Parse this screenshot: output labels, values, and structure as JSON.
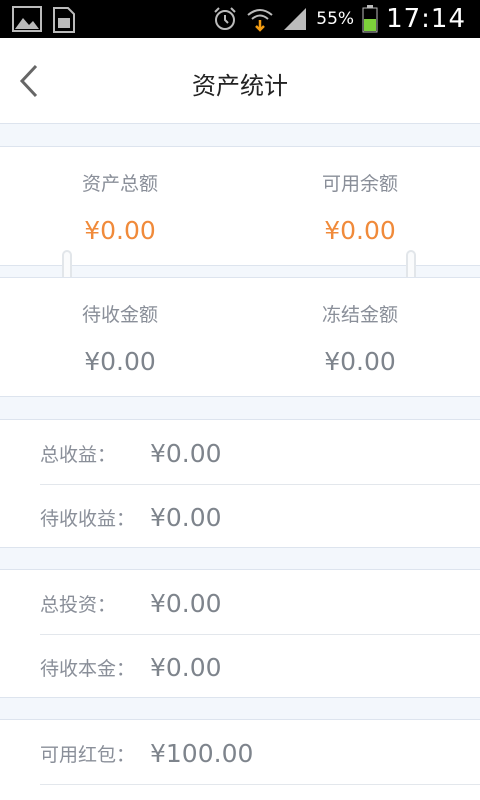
{
  "status_bar": {
    "battery_percent": "55%",
    "time": "17:14",
    "icons": [
      "image-icon",
      "sim-card-icon",
      "alarm-icon",
      "wifi-download-icon",
      "signal-icon",
      "battery-icon"
    ]
  },
  "header": {
    "title": "资产统计",
    "back_icon": "chevron-left-icon"
  },
  "summary": {
    "total_assets_label": "资产总额",
    "total_assets_value": "¥0.00",
    "available_balance_label": "可用余额",
    "available_balance_value": "¥0.00",
    "pending_amount_label": "待收金额",
    "pending_amount_value": "¥0.00",
    "frozen_amount_label": "冻结金额",
    "frozen_amount_value": "¥0.00"
  },
  "earnings": {
    "total_earnings_label": "总收益：",
    "total_earnings_value": "¥0.00",
    "pending_earnings_label": "待收收益：",
    "pending_earnings_value": "¥0.00"
  },
  "investment": {
    "total_investment_label": "总投资：",
    "total_investment_value": "¥0.00",
    "pending_principal_label": "待收本金：",
    "pending_principal_value": "¥0.00"
  },
  "red_packet": {
    "available_red_packet_label": "可用红包：",
    "available_red_packet_value": "¥100.00"
  },
  "colors": {
    "accent_orange": "#f08a3a",
    "value_gray": "#7e848c",
    "label_gray": "#8a8f99",
    "page_bg": "#f3f7fc"
  }
}
